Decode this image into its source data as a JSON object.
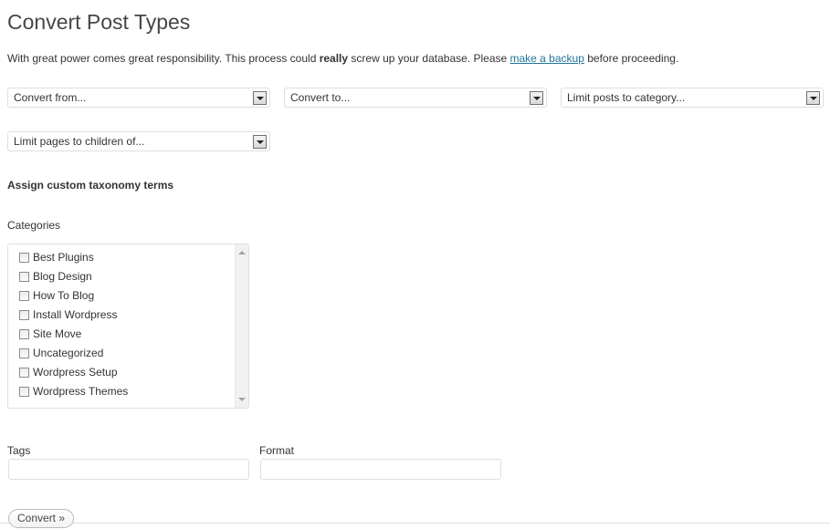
{
  "page": {
    "title": "Convert Post Types",
    "intro": {
      "before": "With great power comes great responsibility. This process could ",
      "emphasis": "really",
      "middle": " screw up your database. Please ",
      "link": "make a backup",
      "after": " before proceeding."
    }
  },
  "selects": {
    "convert_from": "Convert from...",
    "convert_to": "Convert to...",
    "limit_category": "Limit posts to category...",
    "limit_pages": "Limit pages to children of..."
  },
  "taxonomy": {
    "heading": "Assign custom taxonomy terms",
    "categories_label": "Categories",
    "categories": [
      "Best Plugins",
      "Blog Design",
      "How To Blog",
      "Install Wordpress",
      "Site Move",
      "Uncategorized",
      "Wordpress Setup",
      "Wordpress Themes"
    ],
    "tags_label": "Tags",
    "tags_value": "",
    "format_label": "Format",
    "format_value": ""
  },
  "actions": {
    "convert_label": "Convert »"
  },
  "colors": {
    "link": "#21759b",
    "title": "#464646",
    "border": "#dfdfdf"
  }
}
